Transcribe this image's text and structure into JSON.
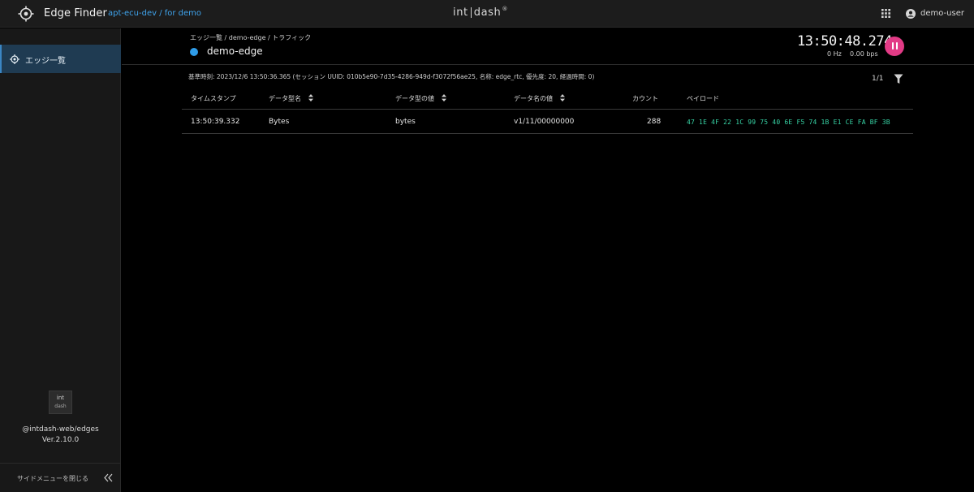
{
  "header": {
    "app_title": "Edge Finder",
    "project_path": "apt-ecu-dev / for demo",
    "brand_left": "int",
    "brand_right": "dash",
    "brand_mark": "®",
    "user_name": "demo-user",
    "icons": {
      "logo": "crosshair-logo-icon",
      "apps": "apps-grid-icon",
      "user": "account-icon"
    }
  },
  "sidebar": {
    "items": [
      {
        "label": "エッジ一覧",
        "icon": "target-icon",
        "active": true
      }
    ],
    "brand_top": "int",
    "brand_bottom": "dash",
    "package": "@intdash-web/edges",
    "version": "Ver.2.10.0",
    "collapse_label": "サイドメニューを閉じる",
    "collapse_icon": "double-chevron-left-icon"
  },
  "main": {
    "breadcrumb": "エッジ一覧 / demo-edge / トラフィック",
    "edge_name": "demo-edge",
    "clock": "13:50:48.274",
    "rate_hz": "0 Hz",
    "rate_bps": "0.00 bps",
    "session_info": "基準時刻: 2023/12/6 13:50:36.365 (セッション UUID: 010b5e90-7d35-4286-949d-f3072f56ae25, 名称: edge_rtc, 優先度: 20, 経過時間: 0)",
    "page_count": "1/1",
    "colors": {
      "accent": "#2f9ce9",
      "pause": "#e23b86",
      "payload": "#37d3a5"
    }
  },
  "table": {
    "columns": [
      "タイムスタンプ",
      "データ型名",
      "データ型の値",
      "データ名の値",
      "カウント",
      "ペイロード"
    ],
    "rows": [
      {
        "timestamp": "13:50:39.332",
        "type_name": "Bytes",
        "type_value": "bytes",
        "name_value": "v1/11/00000000",
        "count": "288",
        "payload": "47 1E 4F 22 1C 99 75 40 6E F5 74 1B E1 CE FA BF 3B"
      }
    ]
  }
}
